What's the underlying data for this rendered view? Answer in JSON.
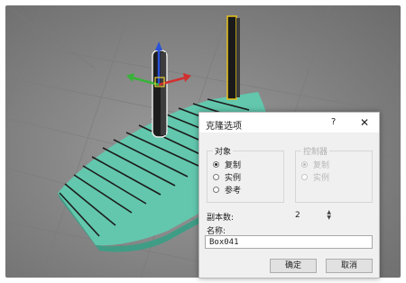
{
  "dialog": {
    "title": "克隆选项",
    "help": "?",
    "close": "✕",
    "object_group": {
      "label": "对象",
      "options": [
        {
          "label": "复制",
          "checked": true
        },
        {
          "label": "实例",
          "checked": false
        },
        {
          "label": "参考",
          "checked": false
        }
      ]
    },
    "controller_group": {
      "label": "控制器",
      "disabled": true,
      "options": [
        {
          "label": "复制",
          "checked": true
        },
        {
          "label": "实例",
          "checked": false
        }
      ]
    },
    "copies_label": "副本数:",
    "copies_value": "2",
    "name_label": "名称:",
    "name_value": "Box041",
    "ok_label": "确定",
    "cancel_label": "取消"
  },
  "colors": {
    "viewport_bg": "#8a8a8a",
    "plank": "#62c7ad",
    "plank_side": "#3f9d86",
    "gap": "#1c1c1c",
    "post_selected": "#e8e8e8",
    "post_yellow": "#e8c21a"
  },
  "icons": {
    "gizmo": "move-transform-gizmo-icon",
    "help": "question-mark-icon",
    "close": "close-x-icon"
  }
}
